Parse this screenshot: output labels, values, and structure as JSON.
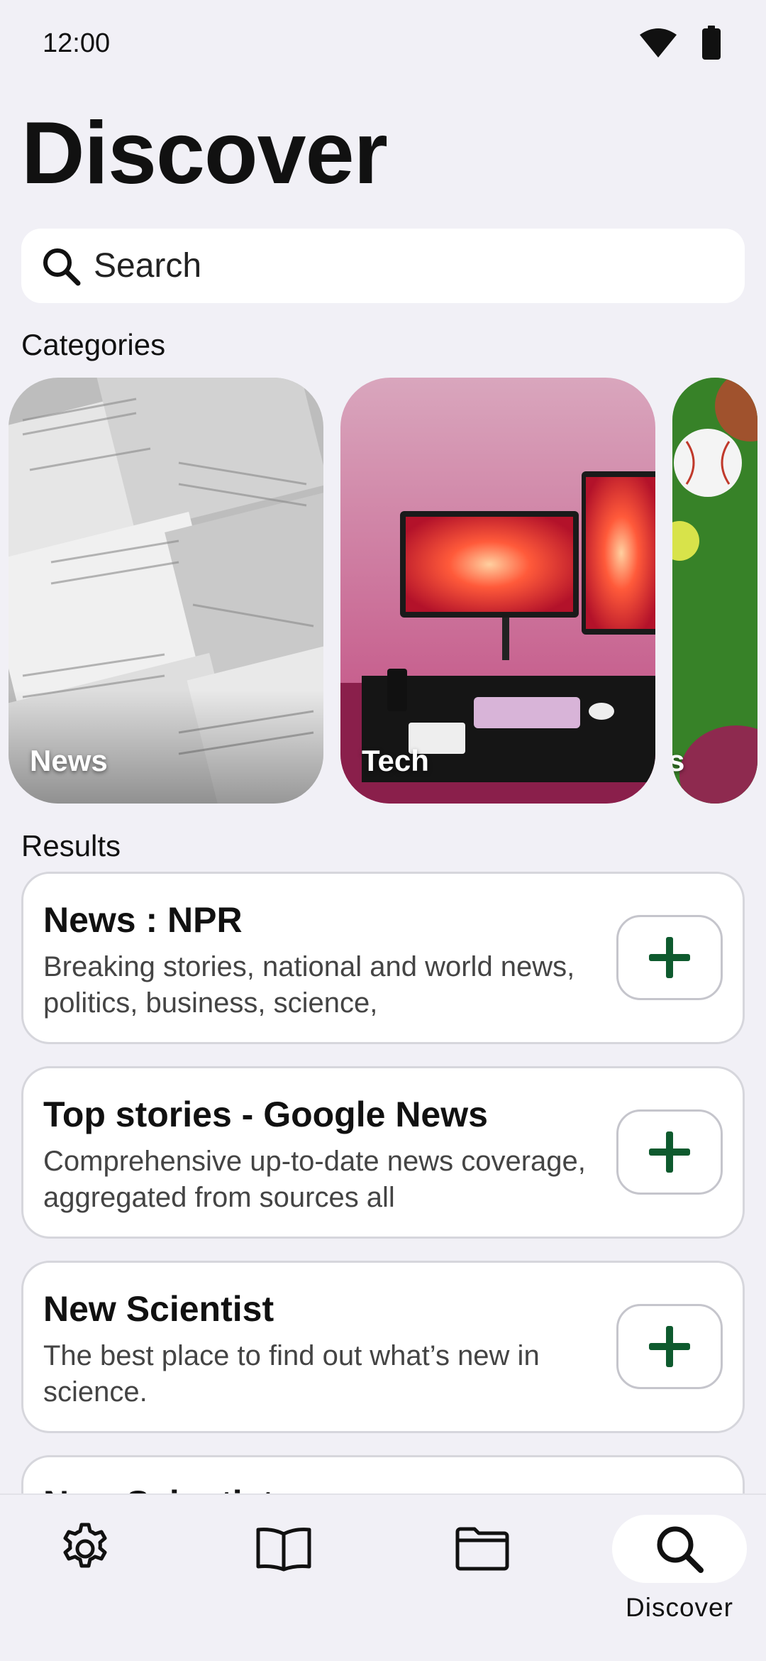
{
  "status_bar": {
    "time": "12:00",
    "icons": [
      "wifi-icon",
      "battery-icon"
    ]
  },
  "page": {
    "title": "Discover"
  },
  "search": {
    "placeholder": "Search"
  },
  "categories": {
    "heading": "Categories",
    "items": [
      {
        "label": "News",
        "icon": "newspaper-image"
      },
      {
        "label": "Tech",
        "icon": "desk-setup-image"
      },
      {
        "label": "s",
        "icon": "baseball-image"
      }
    ]
  },
  "results": {
    "heading": "Results",
    "items": [
      {
        "title": "News : NPR",
        "description": "Breaking stories, national and world news, politics, business, science,"
      },
      {
        "title": "Top stories - Google News",
        "description": "Comprehensive up-to-date news coverage, aggregated from sources all"
      },
      {
        "title": "New Scientist",
        "description": "The best place to find out what’s new in science."
      },
      {
        "title": "New Scientist",
        "description": ""
      }
    ]
  },
  "bottom_nav": {
    "items": [
      {
        "icon": "gear-icon",
        "label": ""
      },
      {
        "icon": "book-icon",
        "label": ""
      },
      {
        "icon": "folder-icon",
        "label": ""
      },
      {
        "icon": "search-icon",
        "label": "Discover",
        "active": true
      }
    ]
  },
  "colors": {
    "background": "#f1f0f6",
    "accent": "#0e5a2e",
    "card": "#ffffff"
  }
}
